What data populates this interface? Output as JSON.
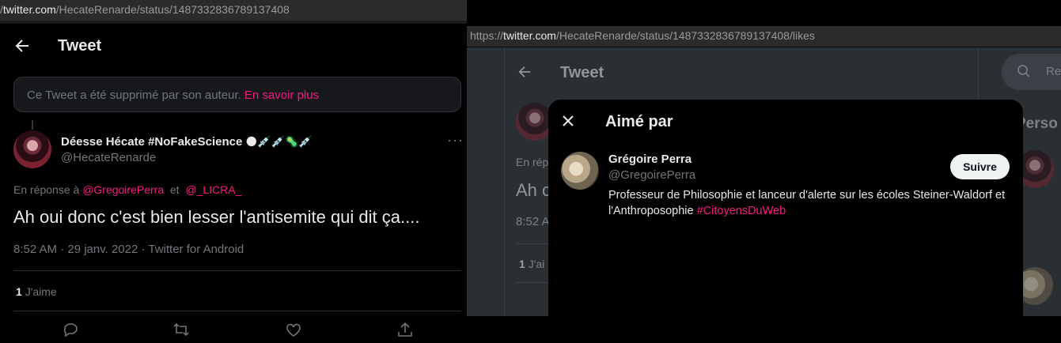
{
  "left": {
    "url_prefix": "/",
    "url_host": "twitter.com",
    "url_path": "/HecateRenarde/status/1487332836789137408",
    "header_title": "Tweet",
    "deleted_notice": "Ce Tweet a été supprimé par son auteur.",
    "deleted_link": "En savoir plus",
    "author_name": "Déesse Hécate #NoFakeScience",
    "author_emojis": "🌑💉💉🦠💉",
    "author_handle": "@HecateRenarde",
    "reply_prefix": "En réponse à",
    "reply_mention_1": "@GregoirePerra",
    "reply_connector": "et",
    "reply_mention_2": "@_LICRA_",
    "tweet_text": "Ah oui donc c'est bien lesser l'antisemite qui dit ça....",
    "tweet_meta": "8:52 AM · 29 janv. 2022 · Twitter for Android",
    "likes_count": "1",
    "likes_label": "J'aime",
    "more_icon": "···"
  },
  "right": {
    "url_scheme": "https://",
    "url_host": "twitter.com",
    "url_path": "/HecateRenarde/status/1487332836789137408/likes",
    "bg_header_title": "Tweet",
    "bg_reply_partial": "En rép",
    "bg_text_partial": "Ah c",
    "bg_time_partial": "8:52 A",
    "bg_likes_partial": "J'ai",
    "bg_likes_count": "1",
    "bg_search_partial": "Re",
    "bg_side_partial": "Perso",
    "modal_title": "Aimé par",
    "user_name": "Grégoire Perra",
    "user_handle": "@GregoirePerra",
    "user_bio": "Professeur de Philosophie et lanceur d'alerte sur les écoles Steiner-Waldorf et l'Anthroposophie",
    "user_bio_hashtag": "#CitoyensDuWeb",
    "follow_label": "Suivre"
  },
  "colors": {
    "accent_pink": "#f91880",
    "text_primary": "#e7e9ea",
    "text_secondary": "#71767b",
    "border": "#2f3336"
  }
}
